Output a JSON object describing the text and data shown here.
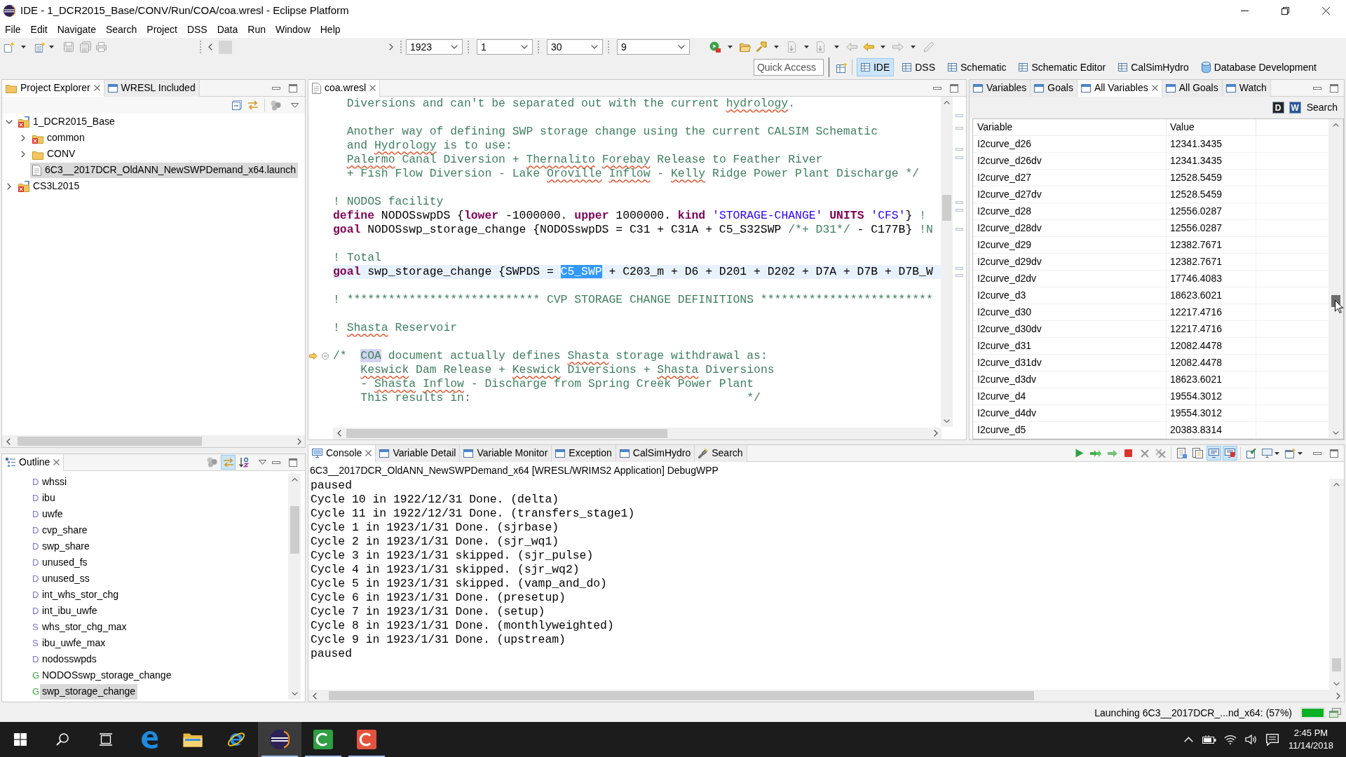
{
  "window": {
    "title": "IDE - 1_DCR2015_Base/CONV/Run/COA/coa.wresl - Eclipse Platform"
  },
  "menu": [
    "File",
    "Edit",
    "Navigate",
    "Search",
    "Project",
    "DSS",
    "Data",
    "Run",
    "Window",
    "Help"
  ],
  "toolbar": {
    "date_fields": [
      {
        "value": "1923"
      },
      {
        "value": "1"
      },
      {
        "value": "30"
      },
      {
        "value": "9"
      }
    ]
  },
  "quick_access": {
    "placeholder": "Quick Access"
  },
  "perspectives": [
    {
      "label": "IDE",
      "kind": "table",
      "selected": true
    },
    {
      "label": "DSS",
      "kind": "table",
      "selected": false
    },
    {
      "label": "Schematic",
      "kind": "table",
      "selected": false
    },
    {
      "label": "Schematic Editor",
      "kind": "table",
      "selected": false
    },
    {
      "label": "CalSimHydro",
      "kind": "table",
      "selected": false
    },
    {
      "label": "Database Development",
      "kind": "database",
      "selected": false
    }
  ],
  "project_explorer": {
    "tabs": [
      {
        "label": "Project Explorer",
        "kind": "explorer",
        "selected": true
      },
      {
        "label": "WRESL Included",
        "kind": "view",
        "selected": false
      }
    ],
    "tree": [
      {
        "label": "1_DCR2015_Base",
        "kind": "project",
        "error": true,
        "expanded": true,
        "selected": false,
        "children": [
          {
            "label": "common",
            "kind": "folder",
            "error": true,
            "expanded": false,
            "selected": false
          },
          {
            "label": "CONV",
            "kind": "folder",
            "error": false,
            "expanded": false,
            "selected": false
          },
          {
            "label": "6C3__2017DCR_OldANN_NewSWPDemand_x64.launch",
            "kind": "file",
            "error": false,
            "selected": true
          }
        ]
      },
      {
        "label": "CS3L2015",
        "kind": "project",
        "error": true,
        "expanded": false,
        "selected": false
      }
    ]
  },
  "outline": {
    "tabs": [
      {
        "label": "Outline",
        "kind": "outline",
        "selected": true
      }
    ],
    "toolbar": [
      {
        "kind": "circles",
        "on": false
      },
      {
        "kind": "swap",
        "on": true
      },
      {
        "kind": "sort",
        "on": false
      }
    ],
    "items": [
      {
        "letter": "D",
        "label": "whssi",
        "color": "#7676dc",
        "selected": false
      },
      {
        "letter": "D",
        "label": "ibu",
        "color": "#7676dc",
        "selected": false
      },
      {
        "letter": "D",
        "label": "uwfe",
        "color": "#7676dc",
        "selected": false
      },
      {
        "letter": "D",
        "label": "cvp_share",
        "color": "#7676dc",
        "selected": false
      },
      {
        "letter": "D",
        "label": "swp_share",
        "color": "#7676dc",
        "selected": false
      },
      {
        "letter": "D",
        "label": "unused_fs",
        "color": "#7676dc",
        "selected": false
      },
      {
        "letter": "D",
        "label": "unused_ss",
        "color": "#7676dc",
        "selected": false
      },
      {
        "letter": "D",
        "label": "int_whs_stor_chg",
        "color": "#7676dc",
        "selected": false
      },
      {
        "letter": "D",
        "label": "int_ibu_uwfe",
        "color": "#7676dc",
        "selected": false
      },
      {
        "letter": "S",
        "label": "whs_stor_chg_max",
        "color": "#7676dc",
        "selected": false
      },
      {
        "letter": "S",
        "label": "ibu_uwfe_max",
        "color": "#7676dc",
        "selected": false
      },
      {
        "letter": "D",
        "label": "nodosswpds",
        "color": "#7676dc",
        "selected": false
      },
      {
        "letter": "G",
        "label": "NODOSswp_storage_change",
        "color": "#3ea043",
        "selected": false
      },
      {
        "letter": "G",
        "label": "swp_storage_change",
        "color": "#3ea043",
        "selected": true
      }
    ]
  },
  "editor": {
    "tabs": [
      {
        "label": "coa.wresl",
        "kind": "file",
        "selected": true
      }
    ],
    "lines": [
      {
        "current": false,
        "tokens": [
          {
            "kind": "comment",
            "text": "  Diversions and can't be separated out with the current "
          },
          {
            "kind": "spelling",
            "text": "hydrology"
          },
          {
            "kind": "comment",
            "text": "."
          }
        ]
      },
      {
        "current": false
      },
      {
        "current": false,
        "tokens": [
          {
            "kind": "comment",
            "text": "  Another way of defining SWP storage change using the current CALSIM Schematic"
          }
        ]
      },
      {
        "current": false,
        "tokens": [
          {
            "kind": "comment",
            "text": "  and "
          },
          {
            "kind": "spelling",
            "text": "Hydrology"
          },
          {
            "kind": "comment",
            "text": " is to use:"
          }
        ]
      },
      {
        "current": false,
        "tokens": [
          {
            "kind": "spelling",
            "text": "  Palermo"
          },
          {
            "kind": "comment",
            "text": " Canal Diversion + "
          },
          {
            "kind": "spelling",
            "text": "Thernalito"
          },
          {
            "kind": "spelling",
            "text": " Forebay"
          },
          {
            "kind": "comment",
            "text": " Release to Feather River"
          }
        ]
      },
      {
        "current": false,
        "tokens": [
          {
            "kind": "comment",
            "text": "  + Fish Flow Diversion - Lake "
          },
          {
            "kind": "spelling",
            "text": "Oroville"
          },
          {
            "kind": "spelling",
            "text": " Inflow"
          },
          {
            "kind": "comment",
            "text": " - "
          },
          {
            "kind": "spelling",
            "text": "Kelly"
          },
          {
            "kind": "comment",
            "text": " Ridge Power Plant Discharge */"
          }
        ]
      },
      {
        "current": false
      },
      {
        "current": false,
        "tokens": [
          {
            "kind": "comment",
            "text": "! NODOS facility"
          }
        ]
      },
      {
        "current": false,
        "tokens": [
          {
            "kind": "keyword",
            "text": "define"
          },
          {
            "kind": "code",
            "text": " NODOSswpDS {"
          },
          {
            "kind": "keyword",
            "text": "lower"
          },
          {
            "kind": "code",
            "text": " -1000000. "
          },
          {
            "kind": "keyword",
            "text": "upper"
          },
          {
            "kind": "code",
            "text": " 1000000. "
          },
          {
            "kind": "keyword",
            "text": "kind"
          },
          {
            "kind": "string",
            "text": " 'STORAGE-CHANGE' "
          },
          {
            "kind": "keyword",
            "text": "UNITS"
          },
          {
            "kind": "string",
            "text": " 'CFS'"
          },
          {
            "kind": "code",
            "text": "} "
          },
          {
            "kind": "comment",
            "text": "!"
          }
        ]
      },
      {
        "current": false,
        "tokens": [
          {
            "kind": "keyword",
            "text": "goal"
          },
          {
            "kind": "code",
            "text": " NODOSswp_storage_change {NODOSswpDS = C31 + C31A + C5_S32SWP "
          },
          {
            "kind": "comment",
            "text": "/*+ D31*/"
          },
          {
            "kind": "code",
            "text": " - C177B} "
          },
          {
            "kind": "comment",
            "text": "!N"
          }
        ]
      },
      {
        "current": false
      },
      {
        "current": false,
        "tokens": [
          {
            "kind": "comment",
            "text": "! Total"
          }
        ]
      },
      {
        "current": true,
        "tokens": [
          {
            "kind": "keyword",
            "text": "goal"
          },
          {
            "kind": "code",
            "text": " swp_storage_change {SWPDS = "
          },
          {
            "kind": "selection",
            "text": "C5_SWP"
          },
          {
            "kind": "code",
            "text": " + C203_m + D6 + D201 + D202 + D7A + D7B + D7B_W"
          }
        ]
      },
      {
        "current": false
      },
      {
        "current": false,
        "tokens": [
          {
            "kind": "comment",
            "text": "! **************************** CVP STORAGE CHANGE DEFINITIONS *************************"
          }
        ]
      },
      {
        "current": false
      },
      {
        "current": false,
        "tokens": [
          {
            "kind": "comment",
            "text": "! "
          },
          {
            "kind": "spelling",
            "text": "Shasta"
          },
          {
            "kind": "comment",
            "text": " Reservoir"
          }
        ]
      },
      {
        "current": false
      },
      {
        "current": false,
        "pointer": true,
        "folded": false,
        "tokens": [
          {
            "kind": "comment",
            "text": "/*  "
          },
          {
            "kind": "match",
            "text": "COA"
          },
          {
            "kind": "comment",
            "text": " document actually defines "
          },
          {
            "kind": "spelling",
            "text": "Shasta"
          },
          {
            "kind": "comment",
            "text": " storage withdrawal as:"
          }
        ]
      },
      {
        "current": false,
        "tokens": [
          {
            "kind": "spelling",
            "text": "    Keswick"
          },
          {
            "kind": "comment",
            "text": " Dam Release + "
          },
          {
            "kind": "spelling",
            "text": "Keswick"
          },
          {
            "kind": "comment",
            "text": " Diversions + "
          },
          {
            "kind": "spelling",
            "text": "Shasta"
          },
          {
            "kind": "comment",
            "text": " Diversions"
          }
        ]
      },
      {
        "current": false,
        "tokens": [
          {
            "kind": "comment",
            "text": "    - "
          },
          {
            "kind": "spelling",
            "text": "Shasta"
          },
          {
            "kind": "spelling",
            "text": " Inflow"
          },
          {
            "kind": "comment",
            "text": " - Discharge from Spring Creek Power Plant"
          }
        ]
      },
      {
        "current": false,
        "tokens": [
          {
            "kind": "comment",
            "text": "    This results in:                                        */"
          }
        ]
      }
    ]
  },
  "variables": {
    "tabs": [
      {
        "label": "Variables",
        "kind": "view",
        "selected": false
      },
      {
        "label": "Goals",
        "kind": "view",
        "selected": false
      },
      {
        "label": "All Variables",
        "kind": "view",
        "selected": true
      },
      {
        "label": "All Goals",
        "kind": "view",
        "selected": false
      },
      {
        "label": "Watch",
        "kind": "view",
        "selected": false
      }
    ],
    "tools": [
      {
        "letter": "D",
        "color": "#262626"
      },
      {
        "letter": "W",
        "color": "#2a579a"
      }
    ],
    "search_button": "Search",
    "columns": [
      "Variable",
      "Value"
    ],
    "rows": [
      [
        "I2curve_d26",
        "12341.3435"
      ],
      [
        "I2curve_d26dv",
        "12341.3435"
      ],
      [
        "I2curve_d27",
        "12528.5459"
      ],
      [
        "I2curve_d27dv",
        "12528.5459"
      ],
      [
        "I2curve_d28",
        "12556.0287"
      ],
      [
        "I2curve_d28dv",
        "12556.0287"
      ],
      [
        "I2curve_d29",
        "12382.7671"
      ],
      [
        "I2curve_d29dv",
        "12382.7671"
      ],
      [
        "I2curve_d2dv",
        "17746.4083"
      ],
      [
        "I2curve_d3",
        "18623.6021"
      ],
      [
        "I2curve_d30",
        "12217.4716"
      ],
      [
        "I2curve_d30dv",
        "12217.4716"
      ],
      [
        "I2curve_d31",
        "12082.4478"
      ],
      [
        "I2curve_d31dv",
        "12082.4478"
      ],
      [
        "I2curve_d3dv",
        "18623.6021"
      ],
      [
        "I2curve_d4",
        "19554.3012"
      ],
      [
        "I2curve_d4dv",
        "19554.3012"
      ],
      [
        "I2curve_d5",
        "20383.8314"
      ]
    ]
  },
  "console": {
    "tabs": [
      {
        "label": "Console",
        "kind": "console",
        "selected": true
      },
      {
        "label": "Variable Detail",
        "kind": "view",
        "selected": false
      },
      {
        "label": "Variable Monitor",
        "kind": "view",
        "selected": false
      },
      {
        "label": "Exception",
        "kind": "view",
        "selected": false
      },
      {
        "label": "CalSimHydro",
        "kind": "view",
        "selected": false
      },
      {
        "label": "Search",
        "kind": "search",
        "selected": false
      }
    ],
    "toolbar": [
      {
        "kind": "play",
        "on": false
      },
      {
        "kind": "double-arrow",
        "on": false
      },
      {
        "kind": "arrow",
        "on": false
      },
      {
        "kind": "stop",
        "on": false
      },
      {
        "kind": "cross",
        "on": false
      },
      {
        "kind": "double-cross",
        "on": false
      },
      {
        "kind": "page",
        "on": false
      },
      {
        "kind": "pages",
        "on": false
      },
      {
        "kind": "screen",
        "on": true
      },
      {
        "kind": "screen-alert",
        "on": true
      },
      {
        "kind": "pin",
        "on": false
      },
      {
        "kind": "display",
        "on": false
      },
      {
        "kind": "new-window",
        "on": false
      }
    ],
    "process": "6C3__2017DCR_OldANN_NewSWPDemand_x64 [WRESL/WRIMS2 Application] DebugWPP",
    "lines": [
      "paused",
      "Cycle 10 in 1922/12/31 Done. (delta)",
      "Cycle 11 in 1922/12/31 Done. (transfers_stage1)",
      "Cycle 1 in 1923/1/31 Done. (sjrbase)",
      "Cycle 2 in 1923/1/31 Done. (sjr_wq1)",
      "Cycle 3 in 1923/1/31 skipped. (sjr_pulse)",
      "Cycle 4 in 1923/1/31 skipped. (sjr_wq2)",
      "Cycle 5 in 1923/1/31 skipped. (vamp_and_do)",
      "Cycle 6 in 1923/1/31 Done. (presetup)",
      "Cycle 7 in 1923/1/31 Done. (setup)",
      "Cycle 8 in 1923/1/31 Done. (monthlyweighted)",
      "Cycle 9 in 1923/1/31 Done. (upstream)",
      "paused"
    ]
  },
  "status_bar": {
    "message": "Launching 6C3__2017DCR_...nd_x64: (57%)",
    "progress": {
      "level": 1
    }
  },
  "taskbar": {
    "apps": [
      {
        "kind": "e-logo",
        "selected": false,
        "running": false
      },
      {
        "kind": "folder",
        "selected": false,
        "running": false
      },
      {
        "kind": "e-ring",
        "selected": false,
        "running": false
      },
      {
        "kind": "striped-circle",
        "selected": true,
        "running": true
      },
      {
        "kind": "c-tile",
        "color": "#2f9e44",
        "selected": false,
        "running": true
      },
      {
        "kind": "c-tile",
        "color": "#e5533d",
        "selected": false,
        "running": true
      }
    ],
    "time": "2:45 PM",
    "date": "11/14/2018"
  }
}
